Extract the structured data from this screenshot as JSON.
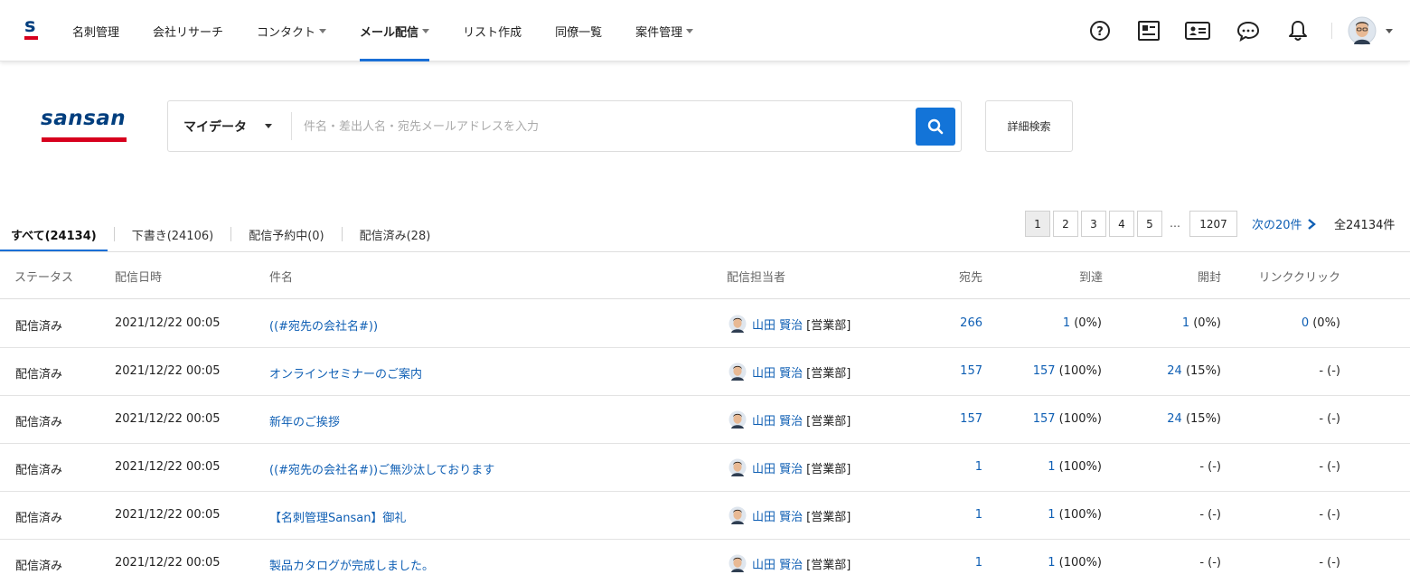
{
  "nav": {
    "items": [
      {
        "label": "名刺管理",
        "dropdown": false,
        "active": false
      },
      {
        "label": "会社リサーチ",
        "dropdown": false,
        "active": false
      },
      {
        "label": "コンタクト",
        "dropdown": true,
        "active": false
      },
      {
        "label": "メール配信",
        "dropdown": true,
        "active": true
      },
      {
        "label": "リスト作成",
        "dropdown": false,
        "active": false
      },
      {
        "label": "同僚一覧",
        "dropdown": false,
        "active": false
      },
      {
        "label": "案件管理",
        "dropdown": true,
        "active": false
      }
    ],
    "icons": [
      "help-icon",
      "contact-card-icon",
      "id-card-icon",
      "chat-icon",
      "bell-icon"
    ]
  },
  "search": {
    "logo_text": "sansan",
    "scope_label": "マイデータ",
    "placeholder": "件名・差出人名・宛先メールアドレスを入力",
    "value": "",
    "advanced_label": "詳細検索"
  },
  "tabs": [
    {
      "label": "すべて(24134)",
      "active": true
    },
    {
      "label": "下書き(24106)",
      "active": false
    },
    {
      "label": "配信予約中(0)",
      "active": false
    },
    {
      "label": "配信済み(28)",
      "active": false
    }
  ],
  "pagination": {
    "pages": [
      "1",
      "2",
      "3",
      "4",
      "5"
    ],
    "current": "1",
    "ellipsis": "…",
    "last": "1207",
    "next_label": "次の20件",
    "total_label": "全24134件"
  },
  "table": {
    "headers": {
      "status": "ステータス",
      "datetime": "配信日時",
      "subject": "件名",
      "sender": "配信担当者",
      "recipients": "宛先",
      "delivered": "到達",
      "opened": "開封",
      "clicks": "リンククリック"
    },
    "rows": [
      {
        "status": "配信済み",
        "datetime": "2021/12/22 00:05",
        "subject": "((#宛先の会社名#))",
        "sender_name": "山田 賢治",
        "sender_dept": "[営業部]",
        "recipients": "266",
        "delivered_num": "1",
        "delivered_pct": " (0%)",
        "opened_num": "1",
        "opened_pct": " (0%)",
        "clicks_num": "0",
        "clicks_pct": " (0%)"
      },
      {
        "status": "配信済み",
        "datetime": "2021/12/22 00:05",
        "subject": "オンラインセミナーのご案内",
        "sender_name": "山田 賢治",
        "sender_dept": "[営業部]",
        "recipients": "157",
        "delivered_num": "157",
        "delivered_pct": " (100%)",
        "opened_num": "24",
        "opened_pct": " (15%)",
        "clicks_num": "",
        "clicks_pct": "- (-)"
      },
      {
        "status": "配信済み",
        "datetime": "2021/12/22 00:05",
        "subject": "新年のご挨拶",
        "sender_name": "山田 賢治",
        "sender_dept": "[営業部]",
        "recipients": "157",
        "delivered_num": "157",
        "delivered_pct": " (100%)",
        "opened_num": "24",
        "opened_pct": " (15%)",
        "clicks_num": "",
        "clicks_pct": "- (-)"
      },
      {
        "status": "配信済み",
        "datetime": "2021/12/22 00:05",
        "subject": "((#宛先の会社名#))ご無沙汰しております",
        "sender_name": "山田 賢治",
        "sender_dept": "[営業部]",
        "recipients": "1",
        "delivered_num": "1",
        "delivered_pct": " (100%)",
        "opened_num": "",
        "opened_pct": "- (-)",
        "clicks_num": "",
        "clicks_pct": "- (-)"
      },
      {
        "status": "配信済み",
        "datetime": "2021/12/22 00:05",
        "subject": "【名刺管理Sansan】御礼",
        "sender_name": "山田 賢治",
        "sender_dept": "[営業部]",
        "recipients": "1",
        "delivered_num": "1",
        "delivered_pct": " (100%)",
        "opened_num": "",
        "opened_pct": "- (-)",
        "clicks_num": "",
        "clicks_pct": "- (-)"
      },
      {
        "status": "配信済み",
        "datetime": "2021/12/22 00:05",
        "subject": "製品カタログが完成しました。",
        "sender_name": "山田 賢治",
        "sender_dept": "[営業部]",
        "recipients": "1",
        "delivered_num": "1",
        "delivered_pct": " (100%)",
        "opened_num": "",
        "opened_pct": "- (-)",
        "clicks_num": "",
        "clicks_pct": "- (-)"
      }
    ]
  },
  "colors": {
    "accent": "#1a6fd6",
    "link": "#0f5fb4",
    "search_button": "#1374d8",
    "brand_red": "#d7001d",
    "brand_navy": "#003e7e"
  }
}
